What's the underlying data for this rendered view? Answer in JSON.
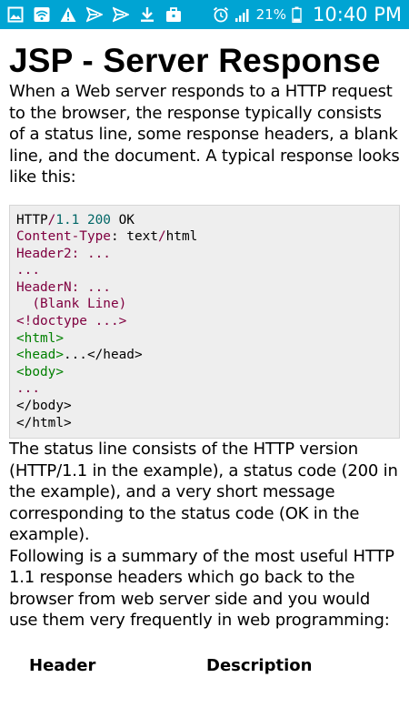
{
  "status_bar": {
    "icons_left": [
      "gallery-icon",
      "wifi-icon",
      "warning-icon",
      "send-icon",
      "send-icon",
      "download-icon",
      "briefcase-icon"
    ],
    "icons_right": [
      "alarm-icon",
      "signal-icon"
    ],
    "battery": "21%",
    "time": "10:40 PM",
    "bg_color": "#00a4d3"
  },
  "page": {
    "title": "JSP - Server Response",
    "intro": "When a Web server responds to a HTTP request to the browser, the response typically consists of a status line, some response headers, a blank line, and the document. A typical response looks like this:",
    "code": {
      "lines": [
        [
          {
            "t": "HTTP",
            "c": "black"
          },
          {
            "t": "/",
            "c": "maroon"
          },
          {
            "t": "1.1 200",
            "c": "teal"
          },
          {
            "t": " OK",
            "c": "black"
          }
        ],
        [
          {
            "t": "Content-Type",
            "c": "maroon"
          },
          {
            "t": ": text",
            "c": "black"
          },
          {
            "t": "/",
            "c": "maroon"
          },
          {
            "t": "html",
            "c": "black"
          }
        ],
        [
          {
            "t": "Header2: ...",
            "c": "maroon"
          }
        ],
        [
          {
            "t": "...",
            "c": "maroon"
          }
        ],
        [
          {
            "t": "HeaderN: ...",
            "c": "maroon"
          }
        ],
        [
          {
            "t": "  (Blank Line)",
            "c": "maroon"
          }
        ],
        [
          {
            "t": "<!doctype ...>",
            "c": "maroon"
          }
        ],
        [
          {
            "t": "<html>",
            "c": "green"
          }
        ],
        [
          {
            "t": "<head>",
            "c": "green"
          },
          {
            "t": "...",
            "c": "black"
          },
          {
            "t": "</head>",
            "c": "black"
          }
        ],
        [
          {
            "t": "<body>",
            "c": "green"
          }
        ],
        [
          {
            "t": "...",
            "c": "maroon"
          }
        ],
        [
          {
            "t": "</body>",
            "c": "black"
          }
        ],
        [
          {
            "t": "</html>",
            "c": "black"
          }
        ]
      ]
    },
    "status_paragraph": "The status line consists of the HTTP version (HTTP/1.1 in the example), a status code (200 in the example), and a very short message corresponding to the status code (OK in the example).",
    "summary_paragraph": "Following is a summary of the most useful HTTP 1.1 response headers which go back to the browser from web server side and you would use them very frequently in web programming:",
    "table": {
      "headers": [
        "Header",
        "Description"
      ]
    }
  }
}
